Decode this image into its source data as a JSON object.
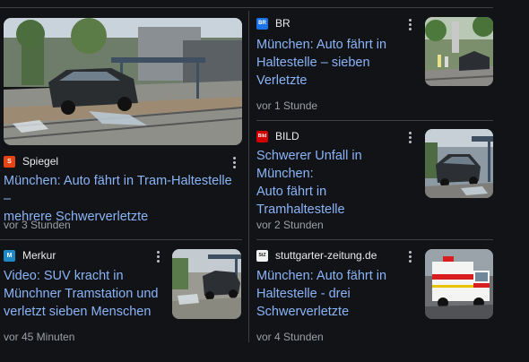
{
  "articles": [
    {
      "source": "Spiegel",
      "logo_text": "S",
      "logo_color": "#e64415",
      "headline_line1": "München: Auto fährt in Tram-Haltestelle –",
      "headline_line2": "mehrere Schwerverletzte",
      "time": "vor 3 Stunden"
    },
    {
      "source": "BR",
      "logo_text": "BR",
      "logo_color": "#1a73e8",
      "headline_line1": "München: Auto fährt in",
      "headline_line2": "Haltestelle – sieben Verletzte",
      "time": "vor 1 Stunde"
    },
    {
      "source": "BILD",
      "logo_text": "Bild",
      "logo_color": "#d40000",
      "headline_line1": "Schwerer Unfall in München:",
      "headline_line2": "Auto fährt in Tramhaltestelle",
      "time": "vor 2 Stunden"
    },
    {
      "source": "Merkur",
      "logo_text": "M",
      "logo_color": "#1e88c7",
      "headline_line1": "Video: SUV kracht in",
      "headline_line2": "Münchner Tramstation und",
      "headline_line3": "verletzt sieben Menschen",
      "time": "vor 45 Minuten"
    },
    {
      "source": "stuttgarter-zeitung.de",
      "logo_text": "StZ",
      "logo_color": "#f2f2f2",
      "headline_line1": "München: Auto fährt in",
      "headline_line2": "Haltestelle - drei",
      "headline_line3": "Schwerverletzte",
      "time": "vor 4 Stunden"
    }
  ],
  "colors": {
    "background": "#121316",
    "headline": "#8ab4f8",
    "time": "#9aa0a6",
    "divider": "#3c4043"
  },
  "icons": {
    "more": "more-vert-icon"
  }
}
